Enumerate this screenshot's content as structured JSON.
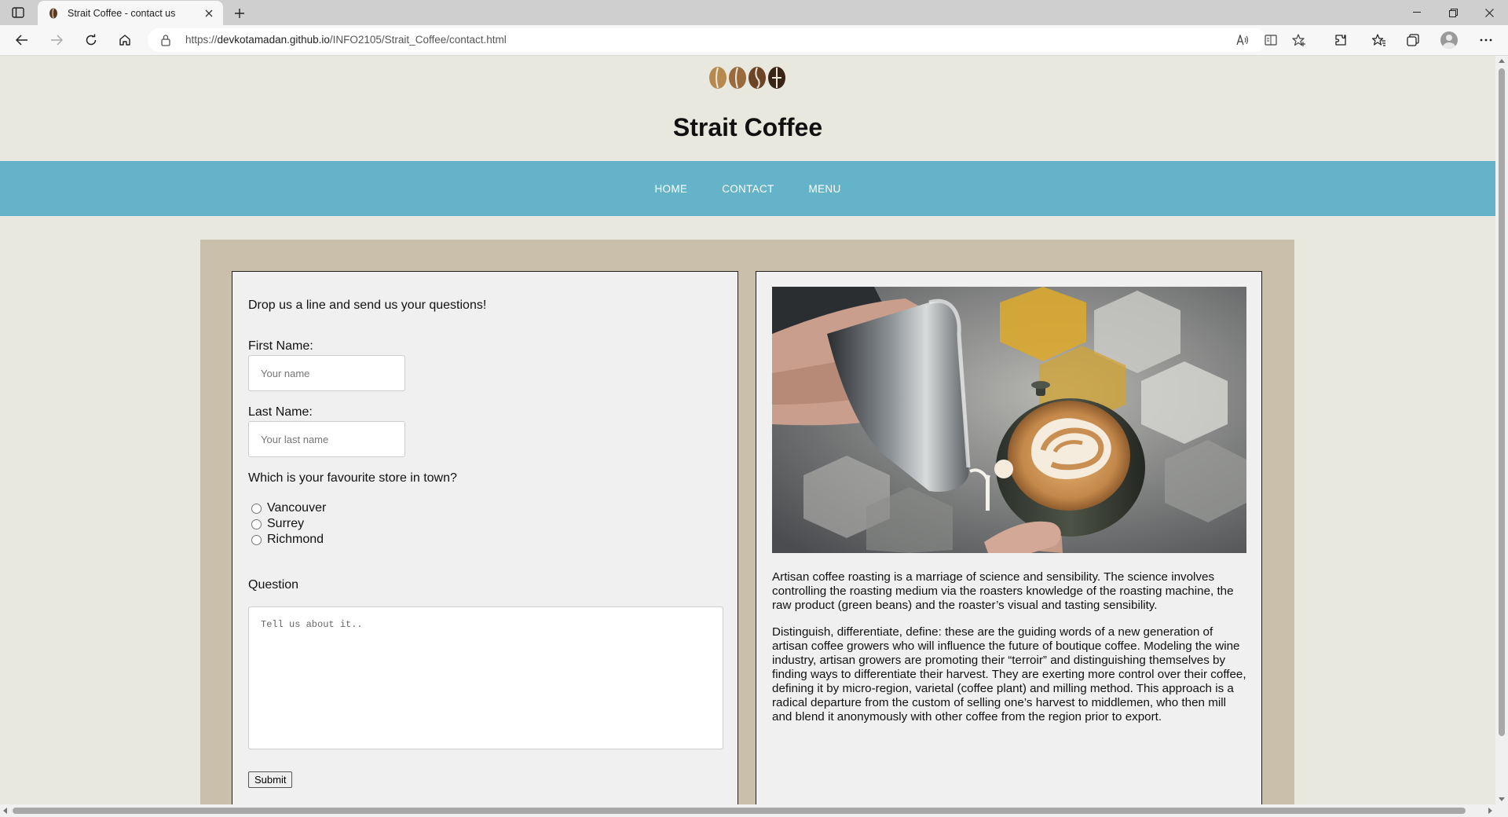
{
  "browser": {
    "tab_title": "Strait Coffee - contact us",
    "url_prefix": "https://",
    "url_host": "devkotamadan.github.io",
    "url_path": "/INFO2105/Strait_Coffee/contact.html"
  },
  "site": {
    "title": "Strait Coffee",
    "nav": [
      "HOME",
      "CONTACT",
      "MENU"
    ],
    "nav_color": "#64b3c9",
    "background": "#e9e8de"
  },
  "form": {
    "intro": "Drop us a line and send us your questions!",
    "first_name_label": "First Name:",
    "first_name_placeholder": "Your name",
    "last_name_label": "Last Name:",
    "last_name_placeholder": "Your last name",
    "store_question": "Which is your favourite store in town?",
    "stores": [
      "Vancouver",
      "Surrey",
      "Richmond"
    ],
    "question_label": "Question",
    "question_placeholder": "Tell us about it..",
    "submit_label": "Submit"
  },
  "content": {
    "paragraph_1": "Artisan coffee roasting is a marriage of science and sensibility. The science involves controlling the roasting medium via the roasters knowledge of the roasting machine, the raw product (green beans) and the roaster’s visual and tasting sensibility.",
    "paragraph_2": "Distinguish, differentiate, define: these are the guiding words of a new generation of artisan coffee growers who will influence the future of boutique coffee. Modeling the wine industry, artisan growers are promoting their “terroir” and distinguishing themselves by finding ways to differentiate their harvest. They are exerting more control over their coffee, defining it by micro-region, varietal (coffee plant) and milling method. This approach is a radical departure from the custom of selling one’s harvest to middlemen, who then mill and blend it anonymously with other coffee from the region prior to export."
  },
  "icons": [
    "sidebar-toggle-icon",
    "coffee-bean-favicon-icon",
    "close-icon",
    "plus-icon",
    "minimize-icon",
    "restore-icon",
    "back-arrow-icon",
    "forward-arrow-icon",
    "refresh-icon",
    "home-icon",
    "lock-icon",
    "read-aloud-icon",
    "reader-view-icon",
    "add-favorite-icon",
    "extensions-icon",
    "favorites-icon",
    "collections-icon",
    "profile-avatar",
    "more-icon"
  ]
}
